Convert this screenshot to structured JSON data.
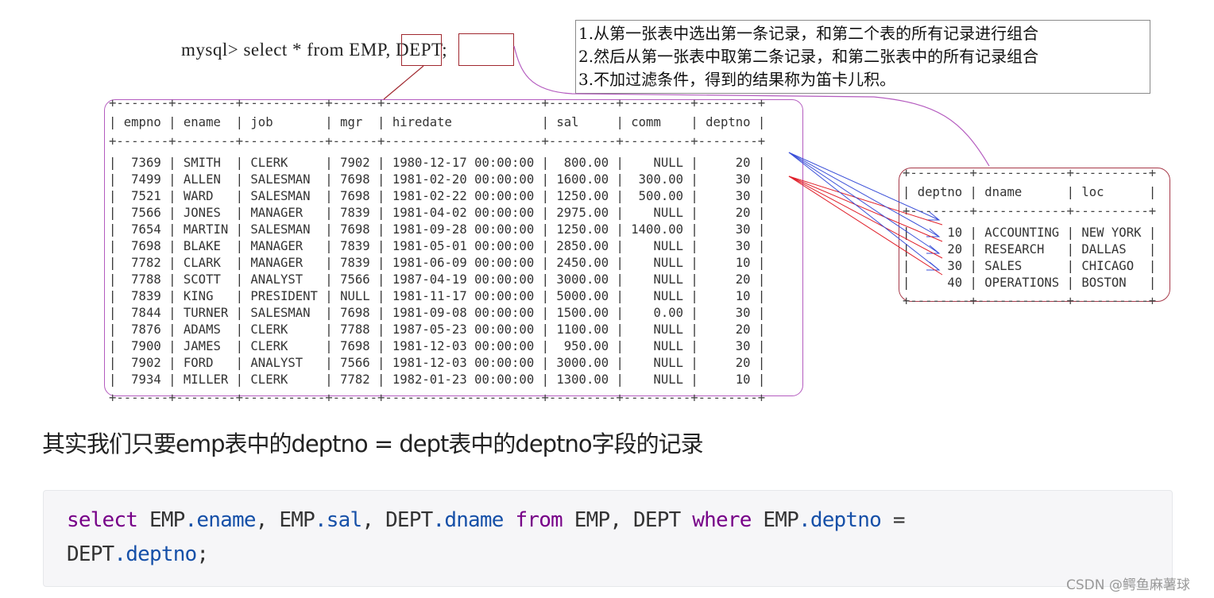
{
  "query_prompt": {
    "prefix": "mysql> select * from ",
    "table1": "EMP",
    "comma": ", ",
    "table2": "DEPT",
    "terminator": ";"
  },
  "notes": [
    "1.从第一张表中选出第一条记录，和第二个表的所有记录进行组合",
    "2.然后从第一张表中取第二条记录，和第二张表中的所有记录组合",
    "3.不加过滤条件，得到的结果称为笛卡儿积。"
  ],
  "emp_table": {
    "columns": [
      "empno",
      "ename",
      "job",
      "mgr",
      "hiredate",
      "sal",
      "comm",
      "deptno"
    ],
    "rows": [
      [
        "7369",
        "SMITH",
        "CLERK",
        "7902",
        "1980-12-17 00:00:00",
        "800.00",
        "NULL",
        "20"
      ],
      [
        "7499",
        "ALLEN",
        "SALESMAN",
        "7698",
        "1981-02-20 00:00:00",
        "1600.00",
        "300.00",
        "30"
      ],
      [
        "7521",
        "WARD",
        "SALESMAN",
        "7698",
        "1981-02-22 00:00:00",
        "1250.00",
        "500.00",
        "30"
      ],
      [
        "7566",
        "JONES",
        "MANAGER",
        "7839",
        "1981-04-02 00:00:00",
        "2975.00",
        "NULL",
        "20"
      ],
      [
        "7654",
        "MARTIN",
        "SALESMAN",
        "7698",
        "1981-09-28 00:00:00",
        "1250.00",
        "1400.00",
        "30"
      ],
      [
        "7698",
        "BLAKE",
        "MANAGER",
        "7839",
        "1981-05-01 00:00:00",
        "2850.00",
        "NULL",
        "30"
      ],
      [
        "7782",
        "CLARK",
        "MANAGER",
        "7839",
        "1981-06-09 00:00:00",
        "2450.00",
        "NULL",
        "10"
      ],
      [
        "7788",
        "SCOTT",
        "ANALYST",
        "7566",
        "1987-04-19 00:00:00",
        "3000.00",
        "NULL",
        "20"
      ],
      [
        "7839",
        "KING",
        "PRESIDENT",
        "NULL",
        "1981-11-17 00:00:00",
        "5000.00",
        "NULL",
        "10"
      ],
      [
        "7844",
        "TURNER",
        "SALESMAN",
        "7698",
        "1981-09-08 00:00:00",
        "1500.00",
        "0.00",
        "30"
      ],
      [
        "7876",
        "ADAMS",
        "CLERK",
        "7788",
        "1987-05-23 00:00:00",
        "1100.00",
        "NULL",
        "20"
      ],
      [
        "7900",
        "JAMES",
        "CLERK",
        "7698",
        "1981-12-03 00:00:00",
        "950.00",
        "NULL",
        "30"
      ],
      [
        "7902",
        "FORD",
        "ANALYST",
        "7566",
        "1981-12-03 00:00:00",
        "3000.00",
        "NULL",
        "20"
      ],
      [
        "7934",
        "MILLER",
        "CLERK",
        "7782",
        "1982-01-23 00:00:00",
        "1300.00",
        "NULL",
        "10"
      ]
    ]
  },
  "dept_table": {
    "columns": [
      "deptno",
      "dname",
      "loc"
    ],
    "rows": [
      [
        "10",
        "ACCOUNTING",
        "NEW YORK"
      ],
      [
        "20",
        "RESEARCH",
        "DALLAS"
      ],
      [
        "30",
        "SALES",
        "CHICAGO"
      ],
      [
        "40",
        "OPERATIONS",
        "BOSTON"
      ]
    ]
  },
  "arrow_colors": {
    "first_row": "#3a4fd8",
    "second_row": "#e0202a",
    "callout": "#b45bbf",
    "highlight": "#a0282f"
  },
  "explanation": "其实我们只要emp表中的deptno = dept表中的deptno字段的记录",
  "code": {
    "line1": [
      {
        "t": "select",
        "c": "kw"
      },
      {
        "t": " EMP",
        "c": ""
      },
      {
        "t": ".ename",
        "c": "prop"
      },
      {
        "t": ", EMP",
        "c": ""
      },
      {
        "t": ".sal",
        "c": "prop"
      },
      {
        "t": ", DEPT",
        "c": ""
      },
      {
        "t": ".dname",
        "c": "prop"
      },
      {
        "t": " ",
        "c": ""
      },
      {
        "t": "from",
        "c": "kw"
      },
      {
        "t": " EMP, DEPT ",
        "c": ""
      },
      {
        "t": "where",
        "c": "kw"
      },
      {
        "t": " EMP",
        "c": ""
      },
      {
        "t": ".deptno",
        "c": "prop"
      },
      {
        "t": " =",
        "c": ""
      }
    ],
    "line2": [
      {
        "t": "DEPT",
        "c": ""
      },
      {
        "t": ".deptno",
        "c": "prop"
      },
      {
        "t": ";",
        "c": ""
      }
    ]
  },
  "watermark": "CSDN @鳄鱼麻薯球"
}
